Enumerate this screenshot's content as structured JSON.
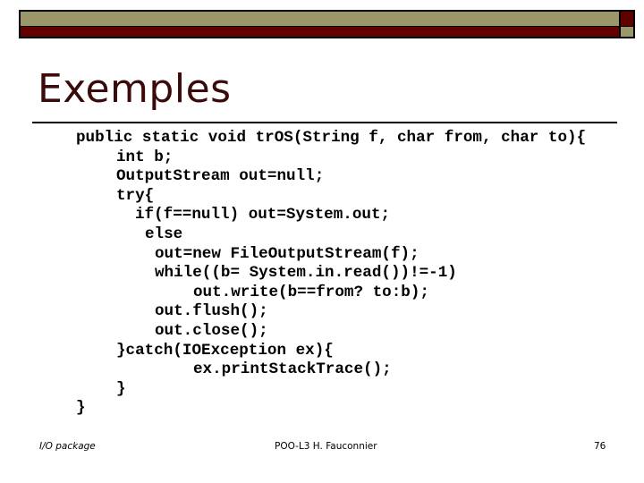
{
  "slide": {
    "title": "Exemples",
    "colors": {
      "olive": "#9a986a",
      "maroon": "#620000",
      "title_text": "#3b0a0a"
    },
    "code_lines": [
      {
        "indent": 0,
        "text": "public static void trOS(String f, char from, char to){"
      },
      {
        "indent": 1,
        "text": "int b;"
      },
      {
        "indent": 1,
        "text": "OutputStream out=null;"
      },
      {
        "indent": 1,
        "text": "try{"
      },
      {
        "indent": 2,
        "text": "if(f==null) out=System.out;"
      },
      {
        "indent": 3,
        "text": "else"
      },
      {
        "indent": 4,
        "text": "out=new FileOutputStream(f);"
      },
      {
        "indent": 4,
        "text": "while((b= System.in.read())!=-1)"
      },
      {
        "indent": 5,
        "text": "out.write(b==from? to:b);"
      },
      {
        "indent": 4,
        "text": "out.flush();"
      },
      {
        "indent": 4,
        "text": "out.close();"
      },
      {
        "indent": 1,
        "text": "}catch(IOException ex){"
      },
      {
        "indent": 5,
        "text": "ex.printStackTrace();"
      },
      {
        "indent": 1,
        "text": "}"
      },
      {
        "indent": 0,
        "text": "}"
      }
    ],
    "footer": {
      "left": "I/O package",
      "center": "POO-L3 H. Fauconnier",
      "page_number": "76"
    }
  }
}
